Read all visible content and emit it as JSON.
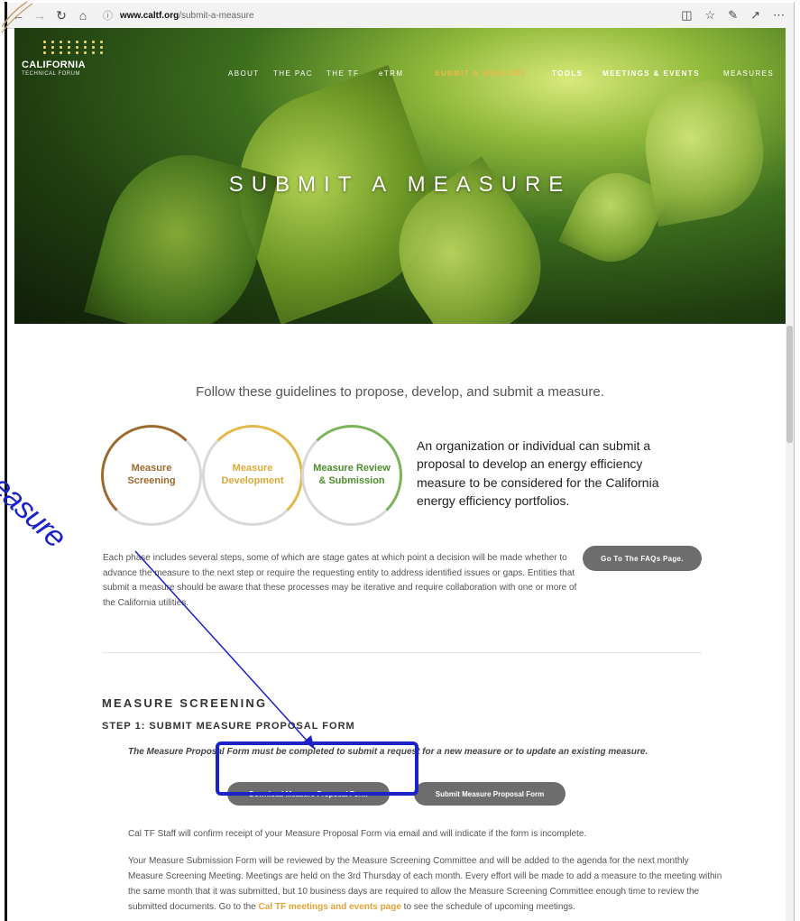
{
  "browser": {
    "url_host": "www.caltf.org",
    "url_path": "/submit-a-measure",
    "icons": [
      "back-icon",
      "forward-icon",
      "refresh-icon",
      "home-icon",
      "info-icon",
      "reading-view-icon",
      "favorite-star-icon",
      "pen-icon",
      "share-icon",
      "more-icon"
    ]
  },
  "logo": {
    "name": "CALIFORNIA",
    "sub": "TECHNICAL FORUM"
  },
  "nav": [
    {
      "label": "ABOUT"
    },
    {
      "label": "THE PAC"
    },
    {
      "label": "THE TF"
    },
    {
      "label": "eTRM"
    },
    {
      "label": "SUBMIT A MEASURE"
    },
    {
      "label": "TOOLS"
    },
    {
      "label": "MEETINGS & EVENTS"
    },
    {
      "label": "MEASURES"
    }
  ],
  "hero": {
    "title": "SUBMIT A MEASURE"
  },
  "intro": {
    "lead": "Follow these guidelines to propose, develop, and submit a measure.",
    "circles": [
      {
        "line1": "Measure",
        "line2": "Screening"
      },
      {
        "line1": "Measure",
        "line2": "Development"
      },
      {
        "line1": "Measure Review",
        "line2": "& Submission"
      }
    ],
    "side_text": "An organization or individual can submit a proposal to develop an energy efficiency measure to be considered for the California energy efficiency portfolios.",
    "phase_text": "Each phase includes several steps, some of which are stage gates at which point a decision will be made whether to advance the measure to the next step or require the requesting entity to address identified issues or gaps. Entities that submit a measure should be aware that these processes may be iterative and require collaboration with one or more of the California utilities.",
    "faq_button": "Go To The FAQs Page."
  },
  "screening": {
    "heading": "MEASURE SCREENING",
    "step1": "STEP 1: SUBMIT MEASURE PROPOSAL FORM",
    "note": "The Measure Proposal Form must be completed to submit a request for a new measure or to update an existing measure.",
    "download_button": "Download Measure Proposal Form",
    "submit_button": "Submit Measure Proposal Form",
    "confirm": "Cal TF Staff will confirm receipt of your Measure Proposal Form via email and will indicate if the form is incomplete.",
    "review_before": "Your Measure Submission Form will be reviewed by the Measure Screening Committee and will be added to the agenda for the next monthly Measure Screening Meeting. Meetings are held on the 3rd Thursday of each month.  Every effort will be made to add a measure to the meeting within the same month that it was submitted, but 10 business days are required to allow the Measure Screening Committee enough time to review the submitted documents. Go to the ",
    "review_link": "Cal TF meetings and events page",
    "review_after": " to see the schedule of upcoming meetings."
  },
  "annotation": {
    "text": "a-measure",
    "color": "#1a22c8"
  }
}
